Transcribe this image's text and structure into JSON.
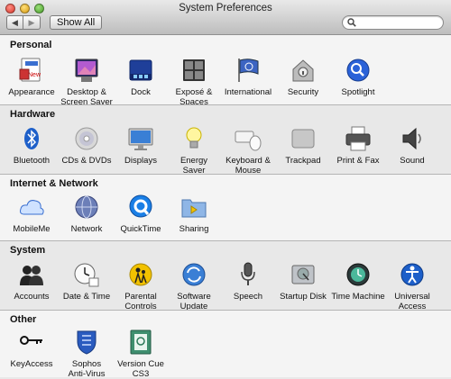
{
  "window": {
    "title": "System Preferences"
  },
  "toolbar": {
    "back": "◀",
    "forward": "▶",
    "show_all": "Show All",
    "search_value": ""
  },
  "sections": [
    {
      "title": "Personal",
      "items": [
        "Appearance",
        "Desktop &\nScreen Saver",
        "Dock",
        "Exposé &\nSpaces",
        "International",
        "Security",
        "Spotlight"
      ]
    },
    {
      "title": "Hardware",
      "items": [
        "Bluetooth",
        "CDs & DVDs",
        "Displays",
        "Energy\nSaver",
        "Keyboard &\nMouse",
        "Trackpad",
        "Print & Fax",
        "Sound"
      ]
    },
    {
      "title": "Internet & Network",
      "items": [
        "MobileMe",
        "Network",
        "QuickTime",
        "Sharing"
      ]
    },
    {
      "title": "System",
      "items": [
        "Accounts",
        "Date & Time",
        "Parental\nControls",
        "Software\nUpdate",
        "Speech",
        "Startup Disk",
        "Time Machine",
        "Universal\nAccess"
      ]
    },
    {
      "title": "Other",
      "items": [
        "KeyAccess",
        "Sophos\nAnti-Virus",
        "Version Cue\nCS3"
      ]
    }
  ]
}
